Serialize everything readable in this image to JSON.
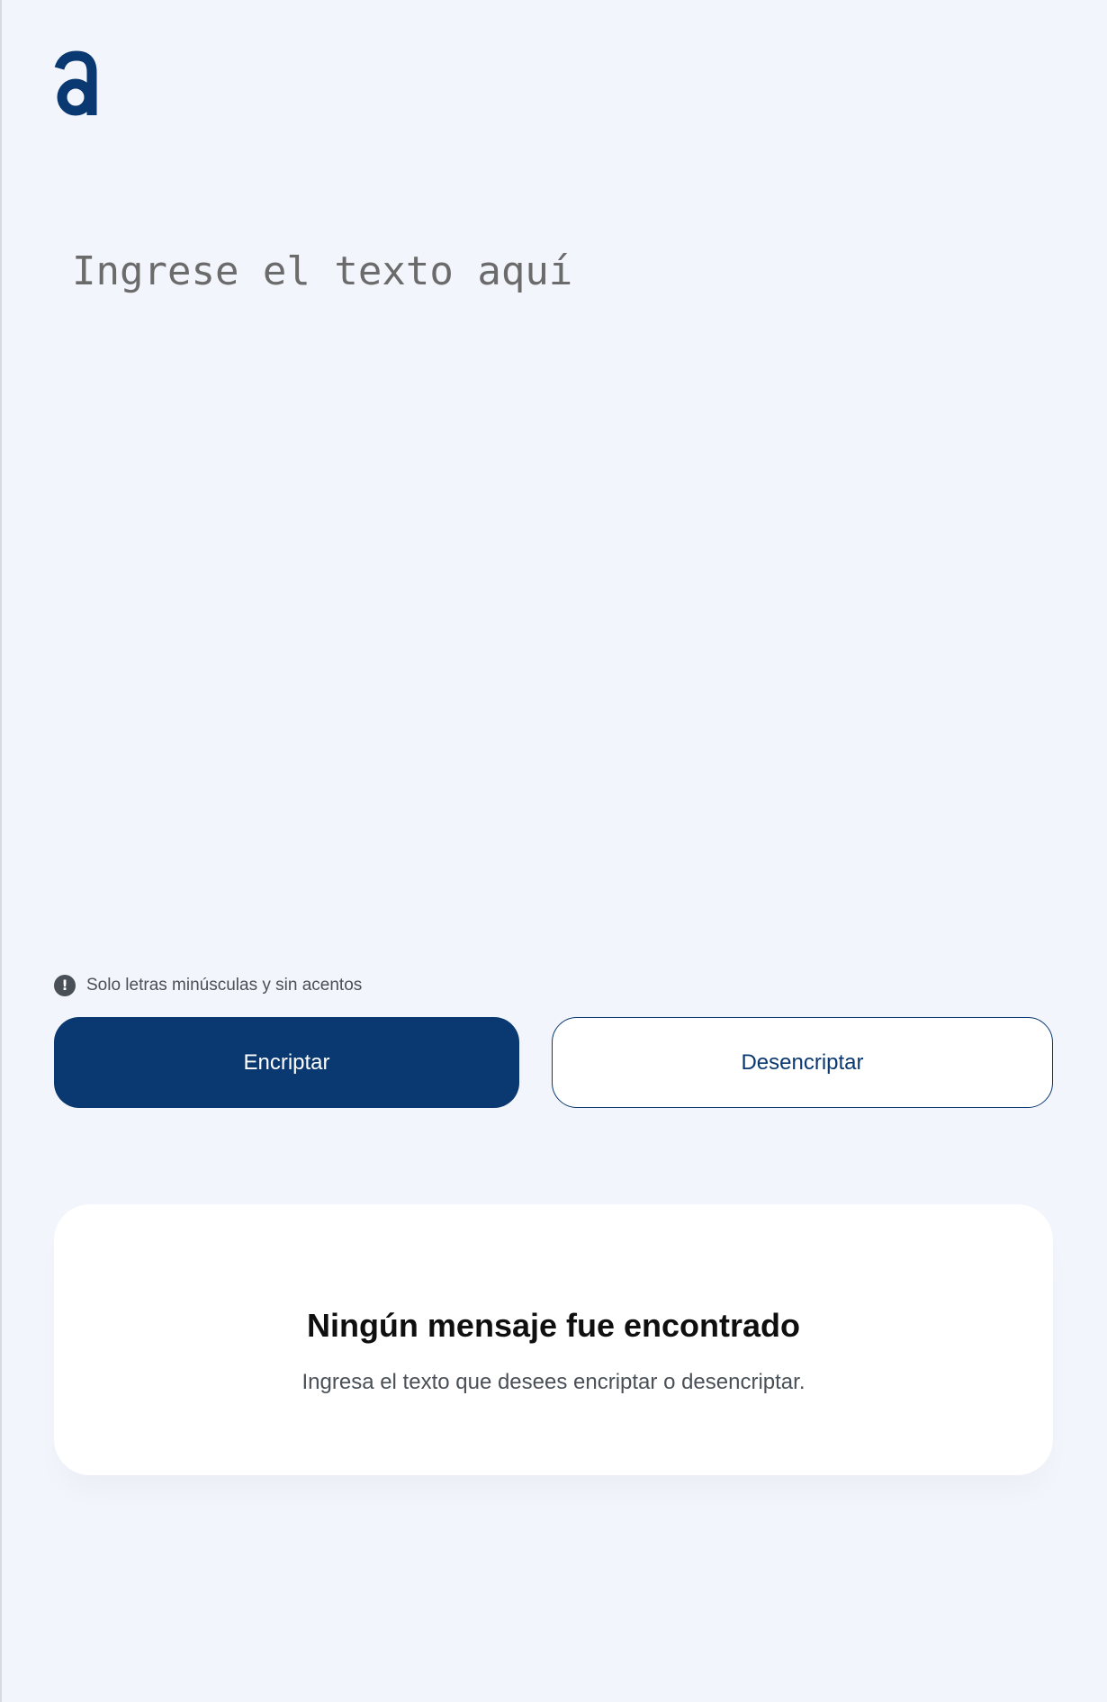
{
  "brand": {
    "logo_icon": "alura-a-logo",
    "accent_color": "#0A3871",
    "background_color": "#F3F5FC"
  },
  "editor": {
    "placeholder": "Ingrese el texto aquí",
    "value": ""
  },
  "hint": {
    "icon": "exclamation-circle-icon",
    "text": "Solo letras minúsculas y sin acentos"
  },
  "actions": {
    "encrypt_label": "Encriptar",
    "decrypt_label": "Desencriptar"
  },
  "result": {
    "title": "Ningún mensaje fue encontrado",
    "subtitle": "Ingresa el texto que desees encriptar o desencriptar."
  }
}
